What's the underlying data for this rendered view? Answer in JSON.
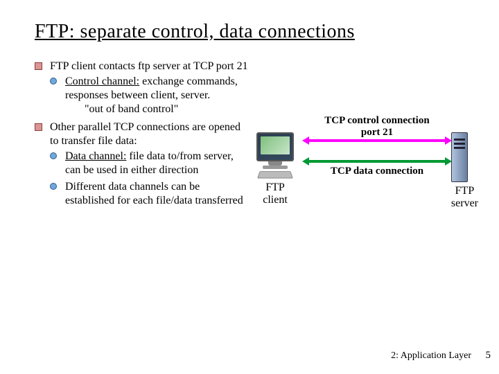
{
  "title": "FTP: separate control, data connections",
  "bullets": [
    {
      "text_a": "FTP client contacts ftp server at TCP port 21",
      "sub": [
        {
          "label": "Control channel:",
          "rest": " exchange commands, responses between client, server.",
          "extra": "\"out of band control\""
        }
      ]
    },
    {
      "text_a": "Other parallel TCP connections are opened to transfer file data:",
      "sub": [
        {
          "label": "Data channel:",
          "rest": " file data to/from server, can be used in either direction"
        },
        {
          "label": "",
          "rest": "Different data channels can be established for each file/data transferred"
        }
      ]
    }
  ],
  "diagram": {
    "client_label": "FTP\nclient",
    "server_label": "FTP\nserver",
    "control_label": "TCP control connection\nport 21",
    "data_label": "TCP data connection"
  },
  "footer": "2: Application Layer",
  "page": "5"
}
